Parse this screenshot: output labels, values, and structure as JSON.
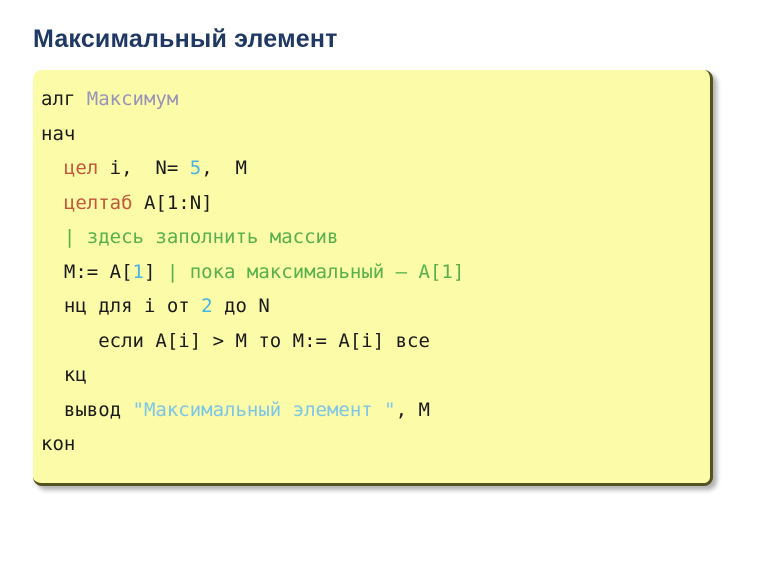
{
  "slide": {
    "title": "Максимальный элемент",
    "title_color": "#1f3864",
    "background_color": "#ffffff"
  },
  "code_panel": {
    "background_color": "#fbfba8",
    "border_color": "#53531f",
    "language": "КуМир (алгоритмический язык)",
    "token_colors": {
      "plain": "#1a1a1a",
      "keyword": "#c4563a",
      "name": "#9a93b8",
      "number": "#46b4e0",
      "string": "#7cc6e8",
      "comment": "#57b04a"
    },
    "lines": [
      {
        "id": "line-1",
        "text": "алг Максимум",
        "tokens": [
          {
            "t": "алг ",
            "c": "plain"
          },
          {
            "t": "Максимум",
            "c": "name"
          }
        ]
      },
      {
        "id": "line-2",
        "text": "нач",
        "tokens": [
          {
            "t": "нач",
            "c": "plain"
          }
        ]
      },
      {
        "id": "line-3",
        "text": "  цел i,  N= 5,  M",
        "tokens": [
          {
            "t": "  ",
            "c": "plain"
          },
          {
            "t": "цел",
            "c": "keyword"
          },
          {
            "t": " i,  N= ",
            "c": "plain"
          },
          {
            "t": "5",
            "c": "number"
          },
          {
            "t": ",  M",
            "c": "plain"
          }
        ]
      },
      {
        "id": "line-4",
        "text": "  целтаб A[1:N]",
        "tokens": [
          {
            "t": "  ",
            "c": "plain"
          },
          {
            "t": "целтаб",
            "c": "keyword"
          },
          {
            "t": " A[1:N]",
            "c": "plain"
          }
        ]
      },
      {
        "id": "line-5",
        "text": "  | здесь заполнить массив",
        "tokens": [
          {
            "t": "  ",
            "c": "plain"
          },
          {
            "t": "| здесь заполнить массив",
            "c": "comment"
          }
        ]
      },
      {
        "id": "line-6",
        "text": "  M:= A[1] | пока максимальный – A[1]",
        "tokens": [
          {
            "t": "  M:= A[",
            "c": "plain"
          },
          {
            "t": "1",
            "c": "number"
          },
          {
            "t": "] ",
            "c": "plain"
          },
          {
            "t": "| пока максимальный – A[1]",
            "c": "comment"
          }
        ]
      },
      {
        "id": "line-7",
        "text": "  нц для i от 2 до N",
        "tokens": [
          {
            "t": "  нц для i от ",
            "c": "plain"
          },
          {
            "t": "2",
            "c": "number"
          },
          {
            "t": " до N",
            "c": "plain"
          }
        ]
      },
      {
        "id": "line-8",
        "text": "     если A[i] > M то M:= A[i] все",
        "tokens": [
          {
            "t": "     если A[i] > M то M:= A[i] все",
            "c": "plain"
          }
        ]
      },
      {
        "id": "line-9",
        "text": "  кц",
        "tokens": [
          {
            "t": "  кц",
            "c": "plain"
          }
        ]
      },
      {
        "id": "line-10",
        "text": "  вывод \"Максимальный элемент \", M",
        "tokens": [
          {
            "t": "  вывод ",
            "c": "plain"
          },
          {
            "t": "\"Максимальный элемент \"",
            "c": "string"
          },
          {
            "t": ", M",
            "c": "plain"
          }
        ]
      },
      {
        "id": "line-11",
        "text": "кон",
        "tokens": [
          {
            "t": "кон",
            "c": "plain"
          }
        ]
      }
    ]
  }
}
